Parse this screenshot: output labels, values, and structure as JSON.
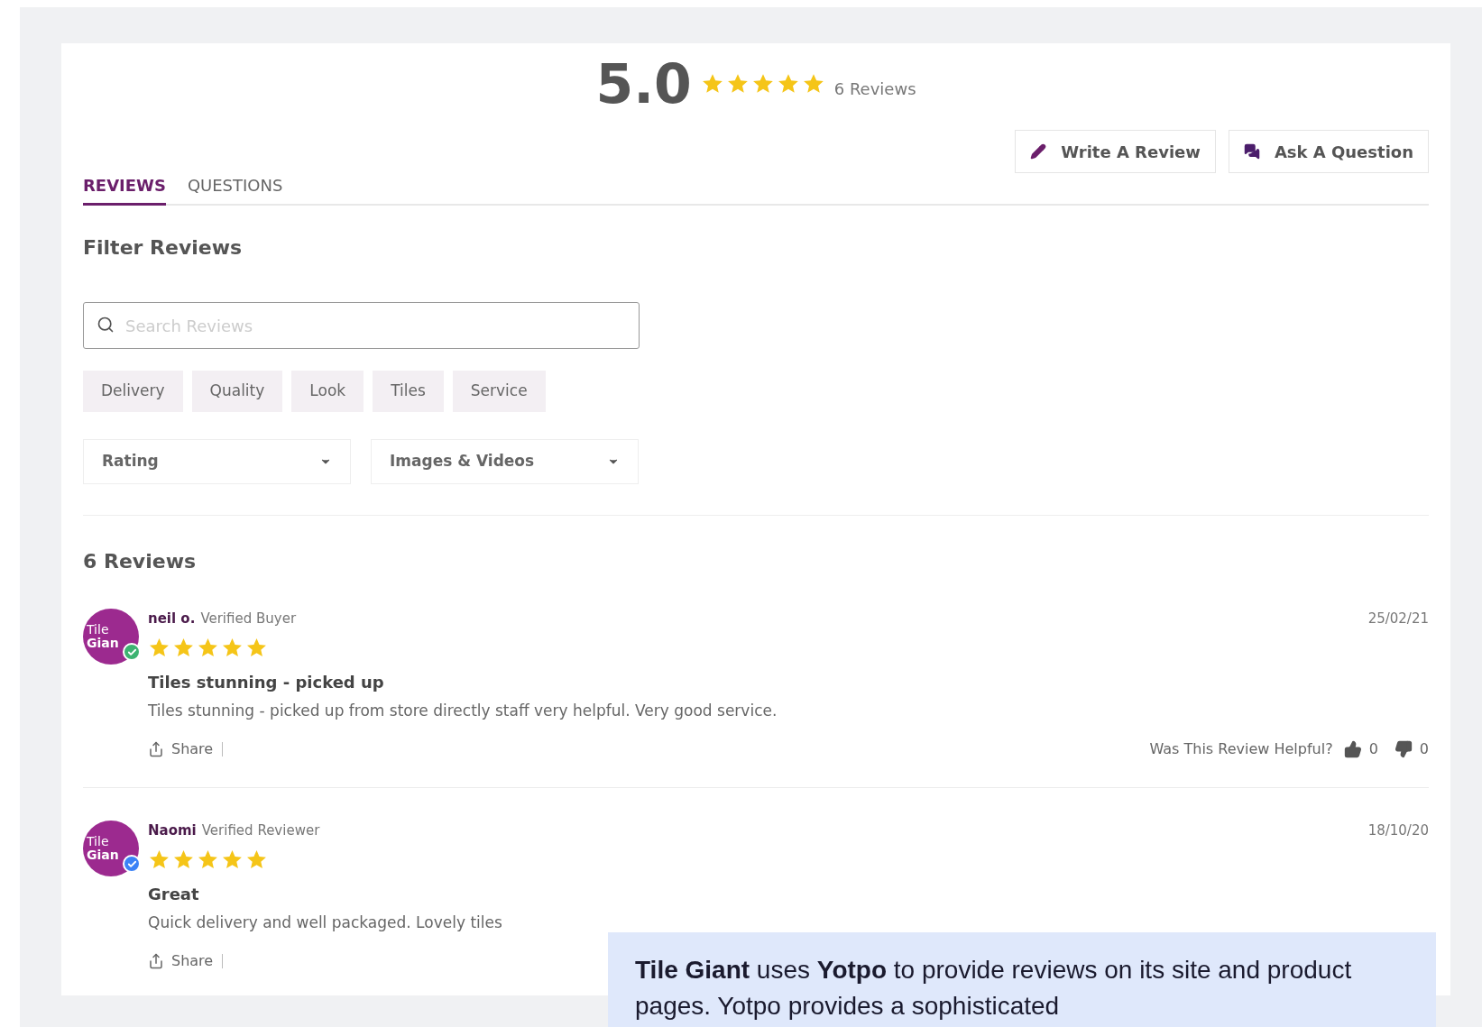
{
  "summary": {
    "score": "5.0",
    "stars": 5,
    "count": "6 Reviews"
  },
  "actions": [
    {
      "kind": "write",
      "label": "Write A Review"
    },
    {
      "kind": "ask",
      "label": "Ask A Question"
    }
  ],
  "tabs": [
    {
      "label": "REVIEWS",
      "selected": true
    },
    {
      "label": "QUESTIONS",
      "selected": false
    }
  ],
  "filter": {
    "title": "Filter Reviews",
    "search": {
      "placeholder": "Search Reviews"
    },
    "chips": [
      "Delivery",
      "Quality",
      "Look",
      "Tiles",
      "Service"
    ],
    "dropdowns": [
      "Rating",
      "Images & Videos"
    ]
  },
  "reviews_heading": "6 Reviews",
  "reviews": [
    {
      "avatar_lines": [
        "Tile",
        "Gian"
      ],
      "color": "#3cb371",
      "name": "neil o.",
      "status": "Verified Buyer",
      "date": "25/02/21",
      "stars": 5,
      "title": "Tiles stunning - picked up",
      "body": "Tiles stunning - picked up from store directly staff very helpful. Very good service.",
      "share": "Share",
      "helpful": {
        "question": "Was This Review Helpful?",
        "up": "0",
        "down": "0"
      }
    },
    {
      "avatar_lines": [
        "Tile",
        "Gian"
      ],
      "color": "#3b82f6",
      "name": "Naomi",
      "status": "Verified Reviewer",
      "date": "18/10/20",
      "stars": 5,
      "title": "Great",
      "body": "Quick delivery and well packaged. Lovely tiles",
      "share": "Share"
    }
  ],
  "callout": "**Tile Giant** uses **Yotpo** to provide reviews on its site and product pages. Yotpo provides a sophisticated"
}
